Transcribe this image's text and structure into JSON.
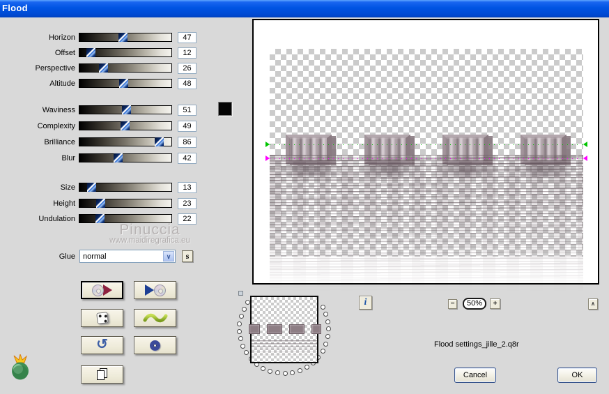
{
  "window": {
    "title": "Flood"
  },
  "sliders": [
    {
      "label": "Horizon",
      "value": "47"
    },
    {
      "label": "Offset",
      "value": "12"
    },
    {
      "label": "Perspective",
      "value": "26"
    },
    {
      "label": "Altitude",
      "value": "48"
    },
    {
      "label": "Waviness",
      "value": "51"
    },
    {
      "label": "Complexity",
      "value": "49"
    },
    {
      "label": "Brilliance",
      "value": "86"
    },
    {
      "label": "Blur",
      "value": "42"
    },
    {
      "label": "Size",
      "value": "13"
    },
    {
      "label": "Height",
      "value": "23"
    },
    {
      "label": "Undulation",
      "value": "22"
    }
  ],
  "color_swatch": "#000000",
  "glue": {
    "label": "Glue",
    "value": "normal",
    "s_button": "s"
  },
  "watermark": {
    "name": "Pinuccia",
    "url": "www.maidiregrafica.eu"
  },
  "preview": {
    "zoom_level": "50%",
    "zoom_minus": "−",
    "zoom_plus": "+",
    "collapse_caret": "∧",
    "info": "i"
  },
  "filename": "Flood settings_jille_2.q8r",
  "actions": {
    "cancel": "Cancel",
    "ok": "OK"
  },
  "icons": {
    "save_settings": "cd-red-play-icon",
    "load_settings": "blue-play-cd-icon",
    "randomize": "dice-icon",
    "wave_random": "green-wave-icon",
    "undo": "undo-arrow-icon",
    "reset": "blue-ring-icon",
    "copy": "pages-icon",
    "logo": "flaming-pear-logo",
    "dropdown_arrow": "chevron-down-icon"
  },
  "guides": {
    "horizon_color": "#00c400",
    "waterline_color": "#ff00ff"
  }
}
